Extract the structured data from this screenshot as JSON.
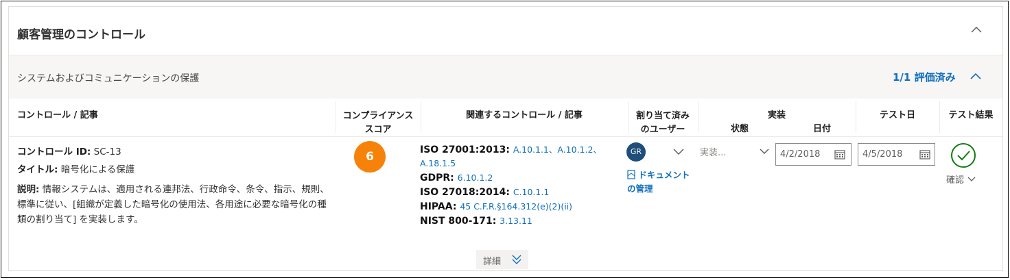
{
  "card": {
    "title": "顧客管理のコントロール"
  },
  "section": {
    "title": "システムおよびコミュニケーションの保護",
    "status": "1/1 評価済み"
  },
  "columns": {
    "control": "コントロール / 記事",
    "score_line1": "コンプライアンス",
    "score_line2": "スコア",
    "related": "関連するコントロール / 記事",
    "assigned_line1": "割り当て済み",
    "assigned_line2": "のユーザー",
    "implementation": "実装",
    "status": "状態",
    "date": "日付",
    "test_date": "テスト日",
    "test_result": "テスト結果"
  },
  "row": {
    "control_id_label": "コントロール ID:",
    "control_id": "SC-13",
    "title_label": "タイトル:",
    "title": "暗号化による保護",
    "description_label": "説明:",
    "description": "情報システムは、適用される連邦法、行政命令、条令、指示、規則、標準に従い、[組織が定義した暗号化の使用法、各用途に必要な暗号化の種類の割り当て] を実装します。",
    "score": "6",
    "related": {
      "iso27001_label": "ISO 27001:2013:",
      "iso27001_links_1": "A.10.1.1、A.10.1.2、",
      "iso27001_links_2": "A.18.1.5",
      "gdpr_label": "GDPR:",
      "gdpr_links": "6.10.1.2",
      "iso27018_label": "ISO 27018:2014:",
      "iso27018_links": "C.10.1.1",
      "hipaa_label": "HIPAA:",
      "hipaa_links": "45 C.F.R.§164.312(e)(2)(ii)",
      "nist_label": "NIST 800-171:",
      "nist_links": "3.13.11"
    },
    "assigned_user_initials": "GR",
    "doc_link_line1": "ドキュメント",
    "doc_link_line2": "の管理",
    "implementation_status": "実装...",
    "implementation_date": "4/2/2018",
    "test_date": "4/5/2018",
    "test_result_label": "確認"
  },
  "details_label": "詳細",
  "colors": {
    "accent": "#106ebe",
    "score": "#f7820a",
    "avatar": "#1e4e79",
    "pass": "#107c10",
    "section_bg": "#f7f6f5"
  },
  "icons": [
    "chevron-up-icon",
    "chevron-down-icon",
    "document-icon",
    "calendar-icon",
    "check-circle-icon",
    "double-chevron-down-icon"
  ]
}
